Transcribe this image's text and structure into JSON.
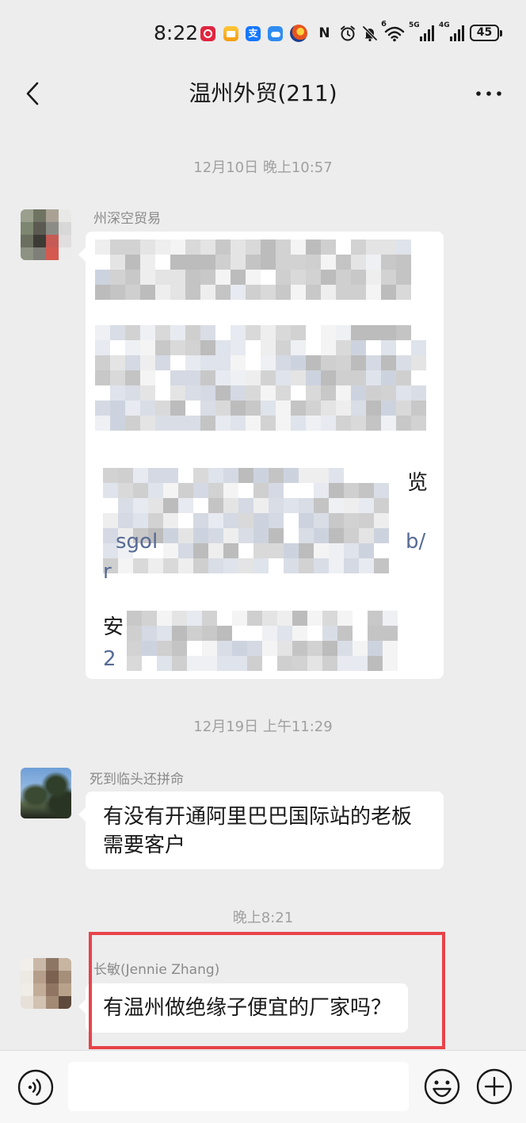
{
  "status_bar": {
    "time": "8:22",
    "alipay_glyph": "支",
    "nfc_glyph": "N",
    "wifi_badge": "6",
    "network_5g": "5G",
    "network_4g": "4G",
    "battery_level": "45",
    "icons": [
      "red-app-icon",
      "mail-app-icon",
      "alipay-icon",
      "cloud-app-icon",
      "game-app-icon",
      "nfc-icon",
      "alarm-icon",
      "mute-icon",
      "wifi-icon",
      "signal-5g-icon",
      "signal-4g-icon",
      "battery-icon"
    ]
  },
  "header": {
    "title": "温州外贸(211)",
    "back_icon": "back-arrow-icon",
    "more_icon": "more-icon"
  },
  "chat": {
    "timestamps": [
      "12月10日 晚上10:57",
      "12月19日 上午11:29",
      "晚上8:21"
    ],
    "messages": [
      {
        "sender": "州深空贸易",
        "visible_fragments": [
          "览",
          "sgol",
          "b/",
          "r",
          "安",
          "2"
        ]
      },
      {
        "sender": "死到临头还拼命",
        "text": "有没有开通阿里巴巴国际站的老板需要客户"
      },
      {
        "sender": "长敏(Jennie Zhang)",
        "text": "有温州做绝缘子便宜的厂家吗？"
      }
    ]
  },
  "input_bar": {
    "value": "",
    "voice_icon": "voice-icon",
    "emoji_icon": "emoji-icon",
    "plus_icon": "plus-icon"
  },
  "colors": {
    "background": "#ededed",
    "bubble": "#ffffff",
    "text": "#191919",
    "link": "#576b95",
    "annotation_box": "#e8434a"
  }
}
